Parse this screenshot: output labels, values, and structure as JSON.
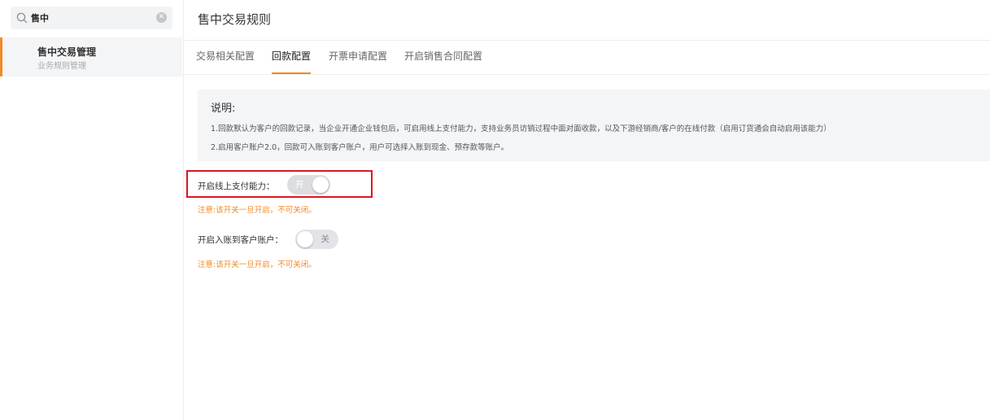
{
  "sidebar": {
    "search": {
      "value": "售中",
      "placeholder": ""
    },
    "items": [
      {
        "title": "售中交易管理",
        "subtitle": "业务规则管理"
      }
    ]
  },
  "page": {
    "title": "售中交易规则"
  },
  "tabs": [
    {
      "label": "交易相关配置",
      "active": false
    },
    {
      "label": "回款配置",
      "active": true
    },
    {
      "label": "开票申请配置",
      "active": false
    },
    {
      "label": "开启销售合同配置",
      "active": false
    }
  ],
  "info": {
    "title": "说明:",
    "lines": [
      "1.回款默认为客户的回款记录，当企业开通企业钱包后，可启用线上支付能力，支持业务员访销过程中面对面收款，以及下游经销商/客户的在线付款（启用订货通会自动启用该能力）",
      "2.启用客户账户2.0，回款可入账到客户账户，用户可选择入账到现金、预存款等账户。"
    ]
  },
  "settings": {
    "online_payment": {
      "label": "开启线上支付能力：",
      "switch_text": "开",
      "state": "on",
      "note": "注意:该开关一旦开启，不可关闭。"
    },
    "customer_account": {
      "label": "开启入账到客户账户：",
      "switch_text": "关",
      "state": "off",
      "note": "注意:该开关一旦开启，不可关闭。"
    }
  },
  "colors": {
    "accent": "#f08a24",
    "highlight_border": "#d9191f",
    "note_text": "#f08a24"
  },
  "icons": {
    "search": "search-icon",
    "clear": "clear-icon"
  }
}
